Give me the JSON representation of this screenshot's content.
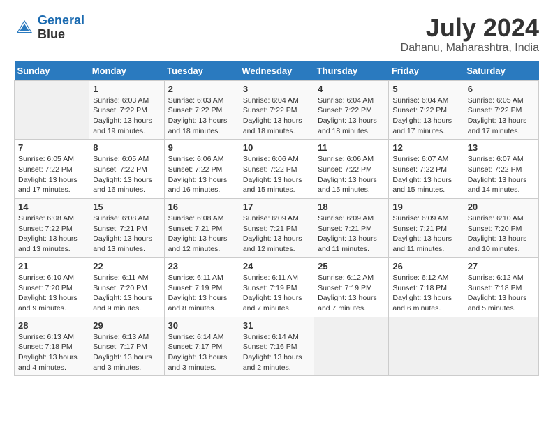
{
  "header": {
    "logo_line1": "General",
    "logo_line2": "Blue",
    "month": "July 2024",
    "location": "Dahanu, Maharashtra, India"
  },
  "weekdays": [
    "Sunday",
    "Monday",
    "Tuesday",
    "Wednesday",
    "Thursday",
    "Friday",
    "Saturday"
  ],
  "weeks": [
    [
      {
        "day": "",
        "empty": true
      },
      {
        "day": "1",
        "sunrise": "6:03 AM",
        "sunset": "7:22 PM",
        "daylight": "13 hours and 19 minutes."
      },
      {
        "day": "2",
        "sunrise": "6:03 AM",
        "sunset": "7:22 PM",
        "daylight": "13 hours and 18 minutes."
      },
      {
        "day": "3",
        "sunrise": "6:04 AM",
        "sunset": "7:22 PM",
        "daylight": "13 hours and 18 minutes."
      },
      {
        "day": "4",
        "sunrise": "6:04 AM",
        "sunset": "7:22 PM",
        "daylight": "13 hours and 18 minutes."
      },
      {
        "day": "5",
        "sunrise": "6:04 AM",
        "sunset": "7:22 PM",
        "daylight": "13 hours and 17 minutes."
      },
      {
        "day": "6",
        "sunrise": "6:05 AM",
        "sunset": "7:22 PM",
        "daylight": "13 hours and 17 minutes."
      }
    ],
    [
      {
        "day": "7",
        "sunrise": "6:05 AM",
        "sunset": "7:22 PM",
        "daylight": "13 hours and 17 minutes."
      },
      {
        "day": "8",
        "sunrise": "6:05 AM",
        "sunset": "7:22 PM",
        "daylight": "13 hours and 16 minutes."
      },
      {
        "day": "9",
        "sunrise": "6:06 AM",
        "sunset": "7:22 PM",
        "daylight": "13 hours and 16 minutes."
      },
      {
        "day": "10",
        "sunrise": "6:06 AM",
        "sunset": "7:22 PM",
        "daylight": "13 hours and 15 minutes."
      },
      {
        "day": "11",
        "sunrise": "6:06 AM",
        "sunset": "7:22 PM",
        "daylight": "13 hours and 15 minutes."
      },
      {
        "day": "12",
        "sunrise": "6:07 AM",
        "sunset": "7:22 PM",
        "daylight": "13 hours and 15 minutes."
      },
      {
        "day": "13",
        "sunrise": "6:07 AM",
        "sunset": "7:22 PM",
        "daylight": "13 hours and 14 minutes."
      }
    ],
    [
      {
        "day": "14",
        "sunrise": "6:08 AM",
        "sunset": "7:22 PM",
        "daylight": "13 hours and 13 minutes."
      },
      {
        "day": "15",
        "sunrise": "6:08 AM",
        "sunset": "7:21 PM",
        "daylight": "13 hours and 13 minutes."
      },
      {
        "day": "16",
        "sunrise": "6:08 AM",
        "sunset": "7:21 PM",
        "daylight": "13 hours and 12 minutes."
      },
      {
        "day": "17",
        "sunrise": "6:09 AM",
        "sunset": "7:21 PM",
        "daylight": "13 hours and 12 minutes."
      },
      {
        "day": "18",
        "sunrise": "6:09 AM",
        "sunset": "7:21 PM",
        "daylight": "13 hours and 11 minutes."
      },
      {
        "day": "19",
        "sunrise": "6:09 AM",
        "sunset": "7:21 PM",
        "daylight": "13 hours and 11 minutes."
      },
      {
        "day": "20",
        "sunrise": "6:10 AM",
        "sunset": "7:20 PM",
        "daylight": "13 hours and 10 minutes."
      }
    ],
    [
      {
        "day": "21",
        "sunrise": "6:10 AM",
        "sunset": "7:20 PM",
        "daylight": "13 hours and 9 minutes."
      },
      {
        "day": "22",
        "sunrise": "6:11 AM",
        "sunset": "7:20 PM",
        "daylight": "13 hours and 9 minutes."
      },
      {
        "day": "23",
        "sunrise": "6:11 AM",
        "sunset": "7:19 PM",
        "daylight": "13 hours and 8 minutes."
      },
      {
        "day": "24",
        "sunrise": "6:11 AM",
        "sunset": "7:19 PM",
        "daylight": "13 hours and 7 minutes."
      },
      {
        "day": "25",
        "sunrise": "6:12 AM",
        "sunset": "7:19 PM",
        "daylight": "13 hours and 7 minutes."
      },
      {
        "day": "26",
        "sunrise": "6:12 AM",
        "sunset": "7:18 PM",
        "daylight": "13 hours and 6 minutes."
      },
      {
        "day": "27",
        "sunrise": "6:12 AM",
        "sunset": "7:18 PM",
        "daylight": "13 hours and 5 minutes."
      }
    ],
    [
      {
        "day": "28",
        "sunrise": "6:13 AM",
        "sunset": "7:18 PM",
        "daylight": "13 hours and 4 minutes."
      },
      {
        "day": "29",
        "sunrise": "6:13 AM",
        "sunset": "7:17 PM",
        "daylight": "13 hours and 3 minutes."
      },
      {
        "day": "30",
        "sunrise": "6:14 AM",
        "sunset": "7:17 PM",
        "daylight": "13 hours and 3 minutes."
      },
      {
        "day": "31",
        "sunrise": "6:14 AM",
        "sunset": "7:16 PM",
        "daylight": "13 hours and 2 minutes."
      },
      {
        "day": "",
        "empty": true
      },
      {
        "day": "",
        "empty": true
      },
      {
        "day": "",
        "empty": true
      }
    ]
  ]
}
